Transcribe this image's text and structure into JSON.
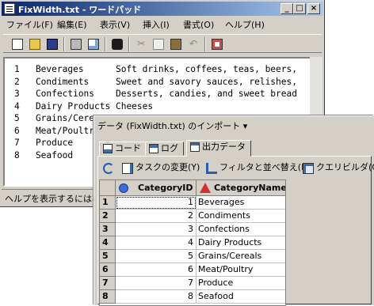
{
  "wordpad": {
    "title": "FixWidth.txt - ワードパッド",
    "menu": [
      "ファイル(F)",
      "編集(E)",
      "表示(V)",
      "挿入(I)",
      "書式(O)",
      "ヘルプ(H)"
    ],
    "document_lines": [
      "1   Beverages      Soft drinks, coffees, teas, beers,",
      "2   Condiments     Sweet and savory sauces, relishes,",
      "3   Confections    Desserts, candies, and sweet bread",
      "4   Dairy Products Cheeses",
      "5   Grains/Cere",
      "6   Meat/Poultr",
      "7   Produce",
      "8   Seafood"
    ],
    "status": "ヘルプを表示するには、F"
  },
  "import_window": {
    "title": "データ (FixWidth.txt) のインポート ▾",
    "tabs": [
      "コード",
      "ログ",
      "出力データ"
    ],
    "toolbar": {
      "change_task": "タスクの変更(Y)",
      "filter_sort": "フィルタと並べ替え(L)",
      "query_builder": "クエリビルダ(Q)"
    },
    "grid": {
      "columns": [
        "CategoryID",
        "CategoryName"
      ],
      "rows": [
        {
          "n": "1",
          "id": "1",
          "name": "Beverages"
        },
        {
          "n": "2",
          "id": "2",
          "name": "Condiments"
        },
        {
          "n": "3",
          "id": "3",
          "name": "Confections"
        },
        {
          "n": "4",
          "id": "4",
          "name": "Dairy Products"
        },
        {
          "n": "5",
          "id": "5",
          "name": "Grains/Cereals"
        },
        {
          "n": "6",
          "id": "6",
          "name": "Meat/Poultry"
        },
        {
          "n": "7",
          "id": "7",
          "name": "Produce"
        },
        {
          "n": "8",
          "id": "8",
          "name": "Seafood"
        }
      ]
    }
  }
}
